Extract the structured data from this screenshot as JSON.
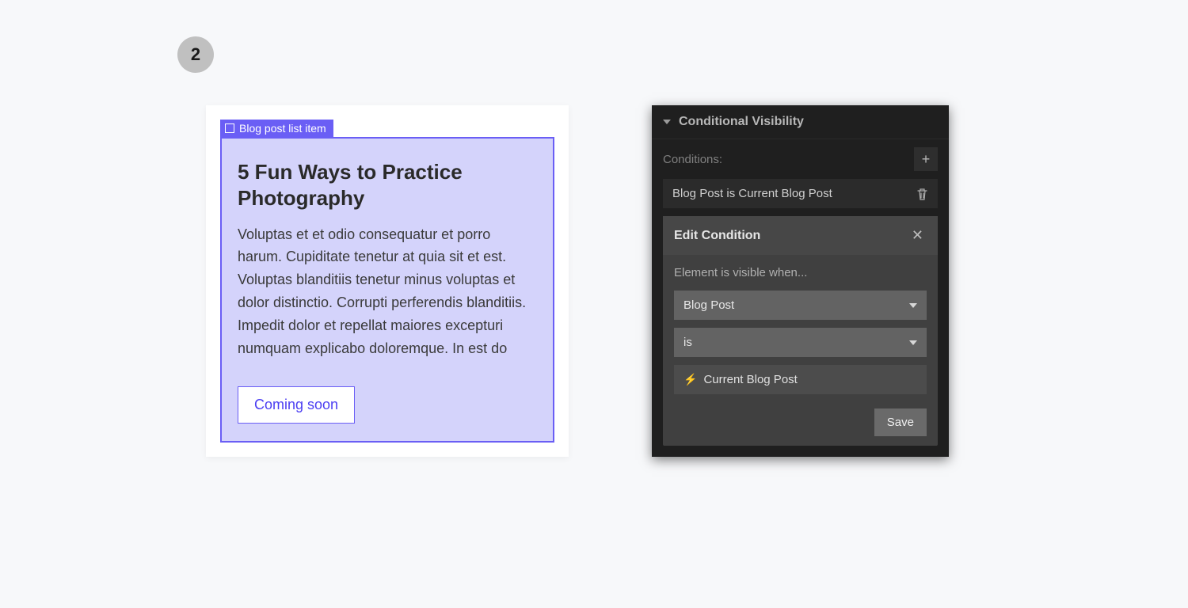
{
  "step": "2",
  "canvas": {
    "element_tag": "Blog post list item",
    "post_title": "5 Fun Ways to Practice Photography",
    "post_body": "Voluptas et et odio consequatur et porro harum. Cupiditate tenetur at quia sit et est. Voluptas blanditiis tenetur minus voluptas et dolor distinctio. Corrupti perferendis blanditiis. Impedit dolor et repellat maiores excepturi numquam explicabo doloremque. In est do",
    "button_label": "Coming soon"
  },
  "panel": {
    "section_title": "Conditional Visibility",
    "conditions_label": "Conditions:",
    "condition_item": "Blog Post is Current Blog Post",
    "edit": {
      "title": "Edit Condition",
      "hint": "Element is visible when...",
      "field_select": "Blog Post",
      "operator_select": "is",
      "value": "Current Blog Post",
      "save_label": "Save"
    }
  }
}
